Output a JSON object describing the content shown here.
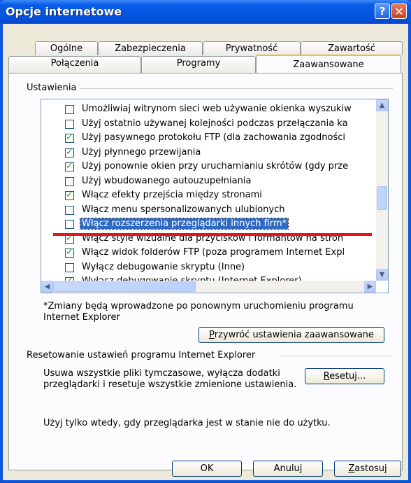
{
  "window": {
    "title": "Opcje internetowe",
    "help_label": "?",
    "close_label": "✕"
  },
  "tabs_row1": [
    "Ogólne",
    "Zabezpieczenia",
    "Prywatność",
    "Zawartość"
  ],
  "tabs_row2": [
    "Połączenia",
    "Programy",
    "Zaawansowane"
  ],
  "active_tab": "Zaawansowane",
  "settings": {
    "group_label": "Ustawienia",
    "items": [
      {
        "checked": false,
        "label": "Umożliwiaj witrynom sieci web używanie okienka wyszukiw"
      },
      {
        "checked": false,
        "label": "Użyj ostatnio używanej kolejności podczas przełączania ka"
      },
      {
        "checked": true,
        "label": "Użyj pasywnego protokołu FTP (dla zachowania zgodności"
      },
      {
        "checked": true,
        "label": "Użyj płynnego przewijania"
      },
      {
        "checked": true,
        "label": "Użyj ponownie okien przy uruchamianiu skrótów (gdy prze"
      },
      {
        "checked": false,
        "label": "Użyj wbudowanego autouzupełniania"
      },
      {
        "checked": true,
        "label": "Włącz efekty przejścia między stronami"
      },
      {
        "checked": false,
        "label": "Włącz menu spersonalizowanych ulubionych"
      },
      {
        "checked": false,
        "label": "Włącz rozszerzenia przeglądarki innych firm*",
        "selected": true
      },
      {
        "checked": true,
        "label": "Włącz style wizualne dla przycisków i formantów na stron"
      },
      {
        "checked": true,
        "label": "Włącz widok folderów FTP (poza programem Internet Expl"
      },
      {
        "checked": false,
        "label": "Wyłącz debugowanie skryptu (Inne)"
      },
      {
        "checked": true,
        "label": "Wyłącz debugowanie skryptu (Internet Explorer)"
      }
    ],
    "note_line1": "*Zmiany będą wprowadzone po ponownym uruchomieniu programu",
    "note_line2": "Internet Explorer",
    "restore_button": "Przywróć ustawienia zaawansowane"
  },
  "reset": {
    "group_label": "Resetowanie ustawień programu Internet Explorer",
    "desc_line1": "Usuwa wszystkie pliki tymczasowe, wyłącza dodatki",
    "desc_line2": "przeglądarki i resetuje wszystkie zmienione ustawienia.",
    "button": "Resetuj...",
    "warning": "Użyj tylko wtedy, gdy przeglądarka jest w stanie nie do użytku."
  },
  "footer": {
    "ok": "OK",
    "cancel": "Anuluj",
    "apply": "Zastosuj"
  }
}
